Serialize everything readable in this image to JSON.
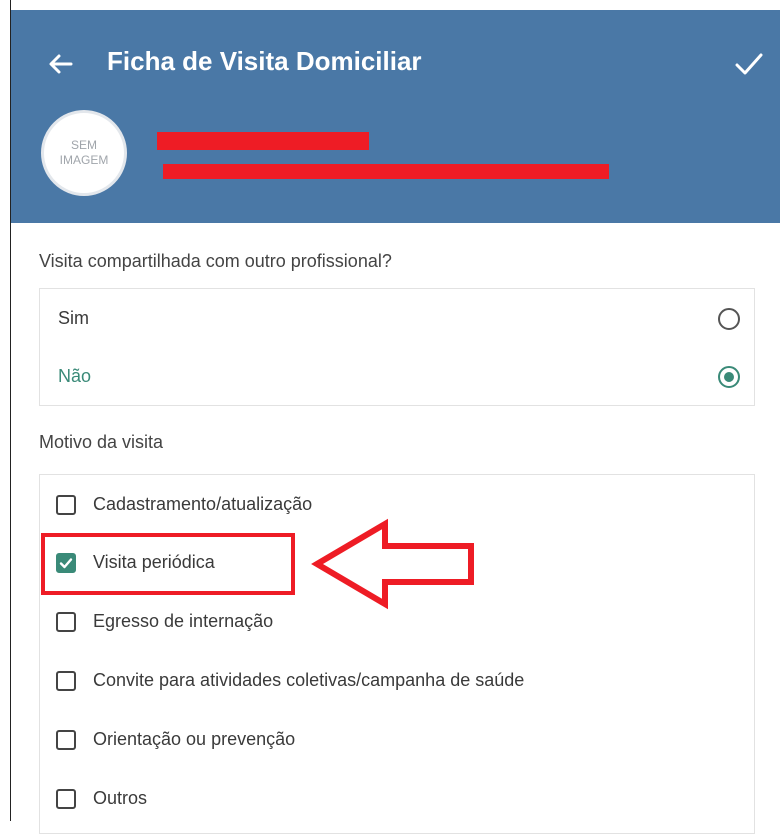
{
  "header": {
    "title": "Ficha de Visita Domiciliar",
    "avatar_line1": "SEM",
    "avatar_line2": "IMAGEM"
  },
  "shared_visit": {
    "question": "Visita compartilhada com outro profissional?",
    "options": [
      {
        "label": "Sim",
        "selected": false
      },
      {
        "label": "Não",
        "selected": true
      }
    ]
  },
  "reason": {
    "label": "Motivo da visita",
    "options": [
      {
        "label": "Cadastramento/atualização",
        "checked": false
      },
      {
        "label": "Visita periódica",
        "checked": true
      },
      {
        "label": "Egresso de internação",
        "checked": false
      },
      {
        "label": "Convite para atividades coletivas/campanha de saúde",
        "checked": false
      },
      {
        "label": "Orientação ou prevenção",
        "checked": false
      },
      {
        "label": "Outros",
        "checked": false
      }
    ]
  },
  "colors": {
    "header_bg": "#4a78a6",
    "accent": "#3a8a78",
    "annotation_red": "#ee1c25"
  },
  "icons": {
    "back": "arrow-left-icon",
    "confirm": "check-icon"
  }
}
